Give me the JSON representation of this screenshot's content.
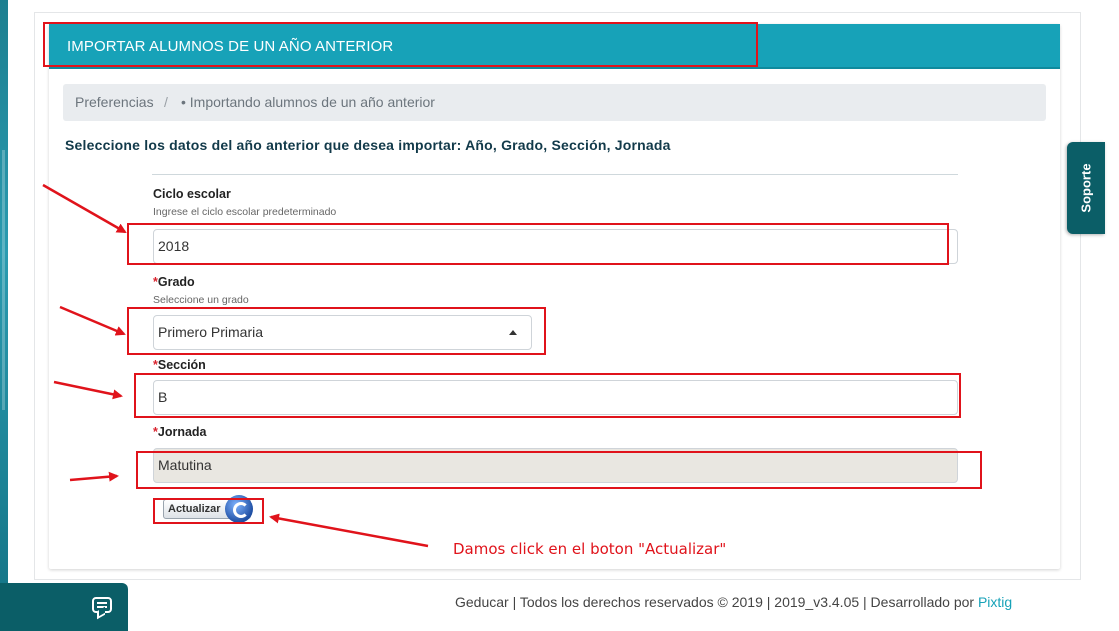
{
  "panel": {
    "title": "IMPORTAR ALUMNOS DE UN AÑO ANTERIOR"
  },
  "breadcrumb": {
    "parent": "Preferencias",
    "separator": "/",
    "current": "• Importando alumnos de un año anterior"
  },
  "instruction": "Seleccione los datos del año anterior que desea importar: Año, Grado, Sección, Jornada",
  "form": {
    "required_mark": "*",
    "ciclo": {
      "label": "Ciclo escolar",
      "help": "Ingrese el ciclo escolar predeterminado",
      "value": "2018"
    },
    "grado": {
      "label": "Grado",
      "help": "Seleccione un grado",
      "value": "Primero Primaria"
    },
    "seccion": {
      "label": "Sección",
      "value": "B"
    },
    "jornada": {
      "label": "Jornada",
      "value": "Matutina"
    },
    "submit_label": "Actualizar"
  },
  "annotation": {
    "text": "Damos click en el boton \"Actualizar\"",
    "color": "#e0131b"
  },
  "side_tab": {
    "label": "Soporte"
  },
  "chat": {
    "icon": "chat-bubble-icon"
  },
  "footer": {
    "text": "Geducar | Todos los derechos reservados © 2019 | 2019_v3.4.05 | Desarrollado por ",
    "link": "Pixtig"
  },
  "colors": {
    "header": "#17a2b8",
    "dark_teal": "#0b5e67",
    "annotation_red": "#e0131b"
  }
}
